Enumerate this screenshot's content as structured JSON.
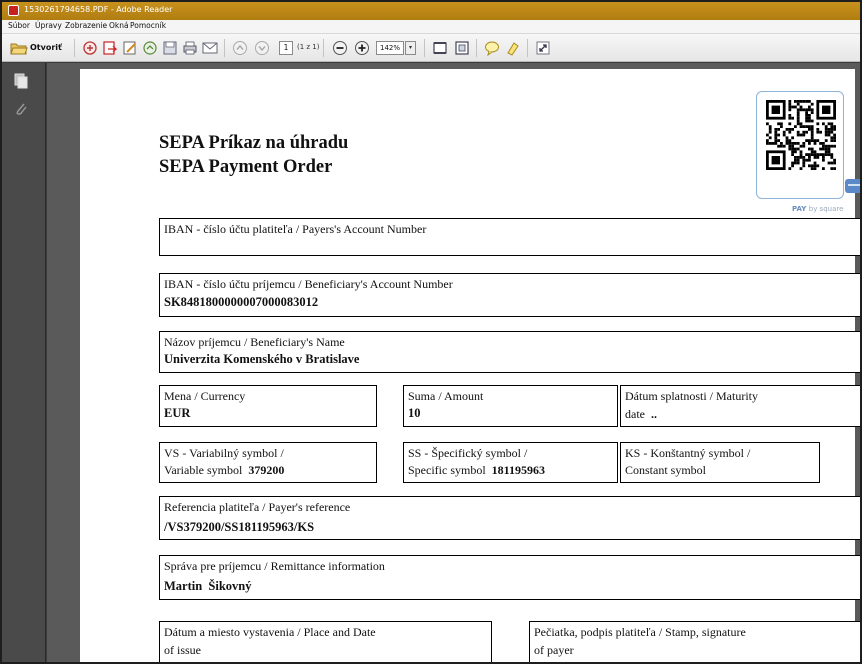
{
  "window": {
    "title": "1530261794658.PDF - Adobe Reader"
  },
  "menu": [
    "Súbor",
    "Úpravy",
    "Zobrazenie",
    "Okná",
    "Pomocník"
  ],
  "toolbar": {
    "open_label": "Otvoriť",
    "page_current": "1",
    "page_of": "(1 z 1)",
    "zoom": "142%",
    "icons": [
      "folder-open-icon",
      "create-pdf-icon",
      "convert-icon",
      "edit-icon",
      "share-icon",
      "save-icon",
      "print-icon",
      "email-icon",
      "page-up-icon",
      "page-down-icon",
      "zoom-out-icon",
      "zoom-in-icon",
      "fit-width-icon",
      "fit-page-icon",
      "comment-icon",
      "highlight-icon",
      "expand-icon"
    ]
  },
  "document": {
    "title_sk": "SEPA Príkaz na úhradu",
    "title_en": "SEPA Payment Order",
    "pay_by_square": "PAY",
    "pay_by_square_suffix": "by square",
    "fields": {
      "payer_iban_label": "IBAN - číslo účtu platiteľa / Payers's Account Number",
      "payer_iban_value": "",
      "beneficiary_iban_label": "IBAN - číslo účtu príjemcu / Beneficiary's Account Number",
      "beneficiary_iban_value": "SK8481800000007000083012",
      "beneficiary_name_label": "Názov príjemcu / Beneficiary's Name",
      "beneficiary_name_value": "Univerzita Komenského v Bratislave",
      "currency_label": "Mena / Currency",
      "currency_value": "EUR",
      "amount_label": "Suma / Amount",
      "amount_value": "10",
      "maturity_label_1": "Dátum splatnosti / Maturity",
      "maturity_label_2": "date",
      "maturity_value": "..",
      "vs_label_1": "VS - Variabilný symbol /",
      "vs_label_2": "Variable symbol",
      "vs_value": "379200",
      "ss_label_1": "SS - Špecifický symbol /",
      "ss_label_2": "Specific symbol",
      "ss_value": "181195963",
      "ks_label_1": "KS - Konštantný symbol /",
      "ks_label_2": "Constant symbol",
      "payer_ref_label": "Referencia platiteľa / Payer's reference",
      "payer_ref_value": "/VS379200/SS181195963/KS",
      "remittance_label": "Správa pre príjemcu / Remittance information",
      "remittance_value": "Martin  Šikovný",
      "issue_label_1": "Dátum a miesto vystavenia / Place and Date",
      "issue_label_2": "of issue",
      "stamp_label_1": "Pečiatka, podpis platiteľa / Stamp, signature",
      "stamp_label_2": "of payer"
    }
  }
}
